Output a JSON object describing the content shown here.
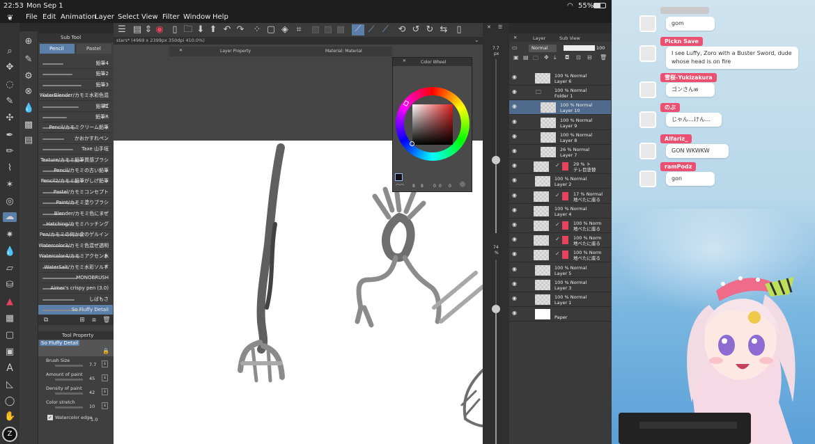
{
  "status": {
    "time": "22:53",
    "date": "Mon Sep 1",
    "battery": "55%"
  },
  "menu": [
    "File",
    "Edit",
    "Animation",
    "Layer",
    "Select",
    "View",
    "Filter",
    "Window",
    "Help"
  ],
  "subtool": {
    "title": "Sub Tool",
    "tabs": [
      "Pencil",
      "Pastel"
    ],
    "brushes": [
      "鉛筆4",
      "鉛筆2",
      "鉛筆3",
      "WaterBlender/カモミ水彩色混ぜ",
      "鉛筆1",
      "鉛筆R",
      "Pencil/カモミクリーム鉛筆",
      "かおかすれペン",
      "Taxe 山手垣",
      "Texture/カモミ鉛筆質感ブラシ",
      "Pencil/カモミの古い鉛筆",
      "Pencil2/カモミ鉛筆がしげ鉛筆",
      "Pastel/カモミコンセプト",
      "Paint/カモミ塗りブラシ",
      "Blender/カモミ色にまぜ",
      "Hatching/カモミハッチング",
      "Pen/カモミの何か食のゲルイン",
      "Watercolor3/カモミ色混ぜ透明水",
      "Watercolor4/カモミアクセントオ",
      "WaterSalt/カモミ水彩ソルト",
      "MONOBRUSH",
      "Aimer's crispy pen (3.0)",
      "しばもさ",
      "So Fluffy Detail"
    ]
  },
  "toolprop": {
    "title": "Tool Property",
    "brush_name": "So Fluffy Detail",
    "props": [
      {
        "label": "Brush Size",
        "value": "7.7"
      },
      {
        "label": "Amount of paint",
        "value": "45"
      },
      {
        "label": "Density of paint",
        "value": "42"
      },
      {
        "label": "Color stretch",
        "value": "10"
      }
    ],
    "watercolor_edge": {
      "label": "Watercolor edge",
      "value": "1.0"
    }
  },
  "document_tab": "stars* (4969 x 2399px 350dpi 410.0%)",
  "panels": {
    "layer_property": "Layer Property",
    "material": "Material: Material"
  },
  "color_wheel": {
    "title": "Color Wheel",
    "values": [
      "8",
      "8",
      "0",
      "0",
      "0"
    ]
  },
  "zoom": {
    "brush_px_value": "7.7",
    "brush_px_unit": "px",
    "opacity_value": "74",
    "opacity_unit": "%"
  },
  "layer_panel": {
    "title": "Layer",
    "tab2": "Sub View",
    "blend": "Normal",
    "opacity": "100",
    "layers": [
      {
        "line1": "100 % Normal",
        "line2": "Layer 6"
      },
      {
        "line1": "100 % Normal",
        "line2": "Folder 1"
      },
      {
        "line1": "100 % Normal",
        "line2": "Layer 10"
      },
      {
        "line1": "100 % Normal",
        "line2": "Layer 9"
      },
      {
        "line1": "100 % Normal",
        "line2": "Layer 8"
      },
      {
        "line1": "26 % Normal",
        "line2": "Layer 7"
      },
      {
        "line1": "29 % ト",
        "line2": "テレ目塗替"
      },
      {
        "line1": "100 % Normal",
        "line2": "Layer 2"
      },
      {
        "line1": "17 % Normal",
        "line2": "地べたに座る"
      },
      {
        "line1": "100 % Normal",
        "line2": "Layer 4"
      },
      {
        "line1": "100 % Norm",
        "line2": "地べたに座る"
      },
      {
        "line1": "100 % Norm",
        "line2": "地べたに座る"
      },
      {
        "line1": "100 % Norm",
        "line2": "地べたに座る"
      },
      {
        "line1": "100 % Normal",
        "line2": "Layer 5"
      },
      {
        "line1": "100 % Normal",
        "line2": "Layer 3"
      },
      {
        "line1": "100 % Normal",
        "line2": "Layer 1"
      },
      {
        "line1": "",
        "line2": "Paper"
      }
    ]
  },
  "chat": [
    {
      "name": "",
      "msg": "gom",
      "color": "#c9c9c9"
    },
    {
      "name": "Pickn Save",
      "msg": "I see Luffy, Zoro with a Buster Sword, dude whose head is on fire",
      "color": "#ec4f6f"
    },
    {
      "name": "雪桜-Yukizakura",
      "msg": "ゴンさんw",
      "color": "#ec4f6f"
    },
    {
      "name": "のぶ",
      "msg": "じゃん…けん…",
      "color": "#ec4f6f"
    },
    {
      "name": "Alfariz_",
      "msg": "GON WKWKW",
      "color": "#ec4f6f"
    },
    {
      "name": "ramPodz",
      "msg": "gon",
      "color": "#ec4f6f"
    }
  ]
}
